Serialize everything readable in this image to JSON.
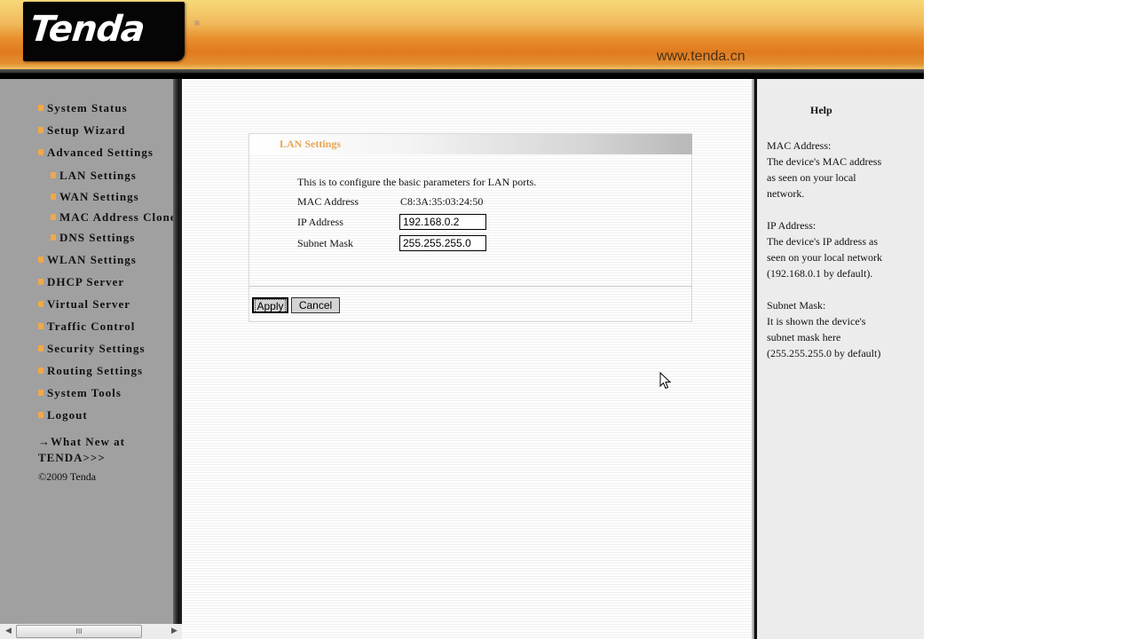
{
  "header": {
    "logo_text": "Tenda",
    "logo_reg": "®",
    "site_url": "www.tenda.cn"
  },
  "sidebar": {
    "items": [
      {
        "label": "System Status",
        "level": 1
      },
      {
        "label": "Setup Wizard",
        "level": 1
      },
      {
        "label": "Advanced Settings",
        "level": 1
      },
      {
        "label": "LAN Settings",
        "level": 2
      },
      {
        "label": "WAN Settings",
        "level": 2
      },
      {
        "label": "MAC Address Clone",
        "level": 2
      },
      {
        "label": "DNS Settings",
        "level": 2
      },
      {
        "label": "WLAN Settings",
        "level": 1
      },
      {
        "label": "DHCP Server",
        "level": 1
      },
      {
        "label": "Virtual Server",
        "level": 1
      },
      {
        "label": "Traffic Control",
        "level": 1
      },
      {
        "label": "Security Settings",
        "level": 1
      },
      {
        "label": "Routing Settings",
        "level": 1
      },
      {
        "label": "System Tools",
        "level": 1
      },
      {
        "label": "Logout",
        "level": 1
      }
    ],
    "whats_new": "→What New at TENDA>>>",
    "copyright": "©2009 Tenda"
  },
  "panel": {
    "title": "LAN Settings",
    "description": "This is to configure the basic parameters for LAN ports.",
    "mac_label": "MAC Address",
    "mac_value": "C8:3A:35:03:24:50",
    "ip_label": "IP Address",
    "ip_value": "192.168.0.2",
    "mask_label": "Subnet Mask",
    "mask_value": "255.255.255.0",
    "apply_label": "Apply",
    "cancel_label": "Cancel"
  },
  "help": {
    "title": "Help",
    "sections": [
      {
        "heading": "MAC Address:",
        "lines": [
          "The device's MAC address",
          "as seen on your local",
          "network."
        ]
      },
      {
        "heading": "IP Address:",
        "lines": [
          "The device's IP address as",
          "seen on your local network",
          "(192.168.0.1 by default)."
        ]
      },
      {
        "heading": "Subnet Mask:",
        "lines": [
          "It is shown the device's",
          "subnet mask here",
          "(255.255.255.0 by default)"
        ]
      }
    ]
  },
  "scrollbar": {
    "left_arrow": "◀",
    "right_arrow": "▶",
    "grip": "III"
  },
  "colors": {
    "accent_orange": "#e07a1e",
    "panel_title": "#e8a654",
    "bullet": "#f0a848"
  }
}
